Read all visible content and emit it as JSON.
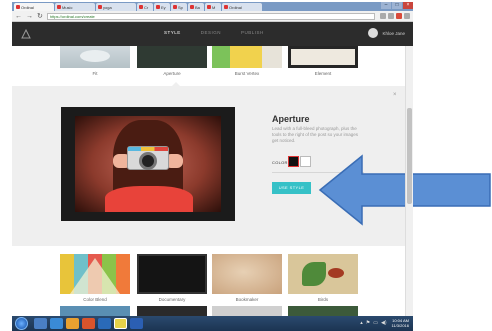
{
  "browser": {
    "tabs": [
      {
        "label": "Ordinal"
      },
      {
        "label": "Music"
      },
      {
        "label": "yoga"
      },
      {
        "label": "Cr"
      },
      {
        "label": "Ey"
      },
      {
        "label": "Sp"
      },
      {
        "label": "Ba"
      },
      {
        "label": "M"
      },
      {
        "label": "Ordinal"
      }
    ],
    "window_controls": [
      "–",
      "□",
      "×"
    ],
    "url": "https://ordinal.com/create"
  },
  "site": {
    "nav": [
      "STYLE",
      "DESIGN",
      "PUBLISH"
    ],
    "user_name": "Khloe Jane"
  },
  "top_row": [
    {
      "caption": "Fit"
    },
    {
      "caption": "Aperture"
    },
    {
      "caption": "Burst Vertex"
    },
    {
      "caption": "Element"
    }
  ],
  "detail": {
    "title": "Aperture",
    "description": "Lead with a full-bleed photograph, plus the tools to the right of the post so your images get noticed.",
    "color_label": "COLOR",
    "swatches": [
      "#111111",
      "#ffffff"
    ],
    "use_button": "USE STYLE",
    "close": "×"
  },
  "bottom_row": [
    {
      "caption": "Color Blend"
    },
    {
      "caption": "Documentary"
    },
    {
      "caption": "Bookmaker"
    },
    {
      "caption": "Birds"
    }
  ],
  "taskbar": {
    "time": "10:04 AM",
    "date": "11/3/2016",
    "tray_icons": [
      "▴",
      "⚑",
      "▭",
      "◀)"
    ]
  },
  "colors": {
    "accent": "#36c1c7",
    "arrow": "#5b8fd4",
    "header": "#2c2c2c"
  }
}
